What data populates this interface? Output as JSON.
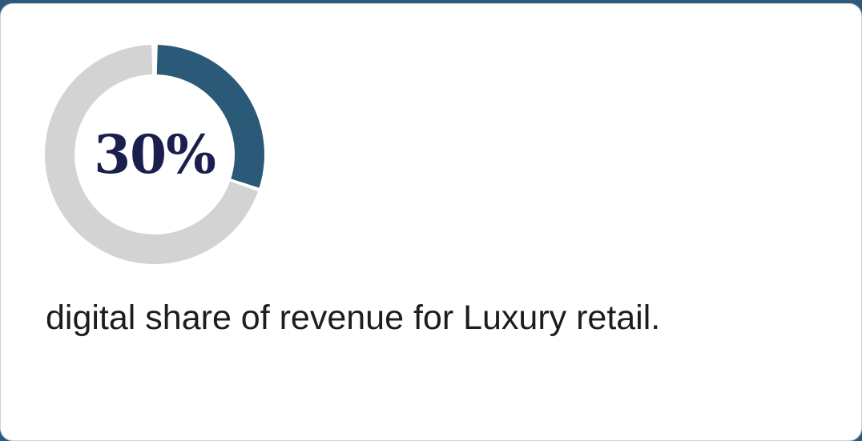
{
  "chart_data": {
    "type": "pie",
    "variant": "donut",
    "value_percent": 30,
    "center_label": "30%",
    "description": "digital share of revenue for Luxury retail.",
    "colors": {
      "filled": "#2a5a78",
      "track": "#d3d3d3",
      "center_text": "#1a1f4e"
    }
  },
  "card": {
    "background": "#ffffff",
    "header_strip_color": "#2c5a78"
  }
}
